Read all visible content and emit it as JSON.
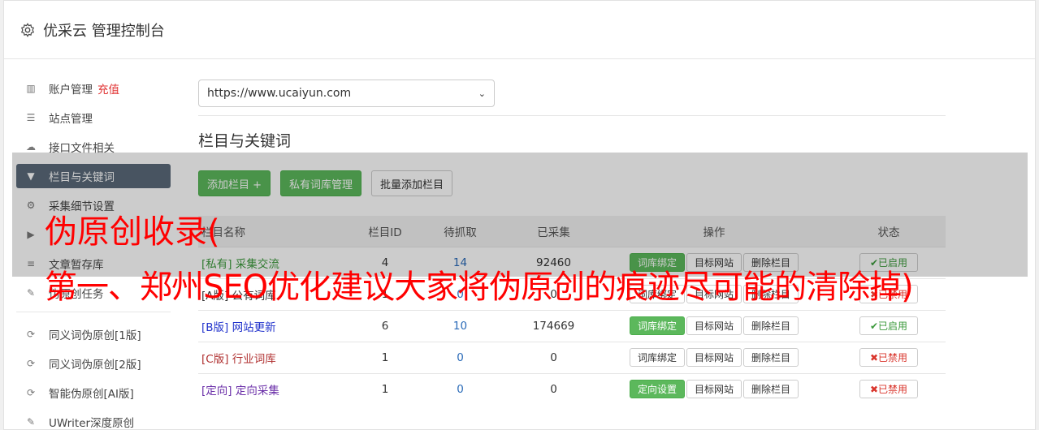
{
  "header": {
    "title": "优采云 管理控制台",
    "icon": "gear-icon"
  },
  "sidebar": {
    "items": [
      {
        "label": "账户管理",
        "extra": "充值",
        "icon": "bar-chart-icon"
      },
      {
        "label": "站点管理",
        "icon": "server-icon"
      },
      {
        "label": "接口文件相关",
        "icon": "cloud-upload-icon"
      },
      {
        "label": "栏目与关键词",
        "icon": "filter-icon",
        "active": true
      },
      {
        "label": "采集细节设置",
        "icon": "cogs-icon"
      },
      {
        "label": "",
        "icon": "play-circle-icon"
      },
      {
        "label": "文章暂存库",
        "icon": "database-icon"
      },
      {
        "label": "伪原创任务",
        "icon": "edit-icon"
      }
    ],
    "tools": [
      {
        "label": "同义词伪原创[1版]",
        "icon": "refresh-icon"
      },
      {
        "label": "同义词伪原创[2版]",
        "icon": "refresh-icon"
      },
      {
        "label": "智能伪原创[AI版]",
        "icon": "refresh-icon"
      },
      {
        "label": "UWriter深度原创",
        "icon": "edit-icon"
      }
    ]
  },
  "main": {
    "site_select": "https://www.ucaiyun.com",
    "section_title": "栏目与关键词",
    "buttons": {
      "add_column": "添加栏目 +",
      "private_lib": "私有词库管理",
      "batch_add": "批量添加栏目"
    },
    "table": {
      "headers": [
        "栏目名称",
        "栏目ID",
        "待抓取",
        "已采集",
        "操作",
        "状态"
      ],
      "rows": [
        {
          "tag": "[私有]",
          "name": "采集交流",
          "id": "4",
          "pending": "14",
          "collected": "92460",
          "op1": "词库绑定",
          "op1_style": "green",
          "op2": "目标网站",
          "op3": "删除栏目",
          "status": "✔已启用",
          "status_type": "on",
          "color": "green"
        },
        {
          "tag": "[A版]",
          "name": "公有词库",
          "id": "1",
          "pending": "0",
          "collected": "0",
          "op1": "词库绑定",
          "op1_style": "default",
          "op2": "目标网站",
          "op3": "删除栏目",
          "status": "✖已禁用",
          "status_type": "off",
          "color": "black"
        },
        {
          "tag": "[B版]",
          "name": "网站更新",
          "id": "6",
          "pending": "10",
          "collected": "174669",
          "op1": "词库绑定",
          "op1_style": "green",
          "op2": "目标网站",
          "op3": "删除栏目",
          "status": "✔已启用",
          "status_type": "on",
          "color": "blue"
        },
        {
          "tag": "[C版]",
          "name": "行业词库",
          "id": "1",
          "pending": "0",
          "collected": "0",
          "op1": "词库绑定",
          "op1_style": "default",
          "op2": "目标网站",
          "op3": "删除栏目",
          "status": "✖已禁用",
          "status_type": "off",
          "color": "red"
        },
        {
          "tag": "[定向]",
          "name": "定向采集",
          "id": "1",
          "pending": "0",
          "collected": "0",
          "op1": "定向设置",
          "op1_style": "green",
          "op2": "目标网站",
          "op3": "删除栏目",
          "status": "✖已禁用",
          "status_type": "off",
          "color": "purple"
        }
      ]
    }
  },
  "watermark": {
    "line1": "伪原创收录(",
    "line2": "第一、郑州SEO优化建议大家将伪原创的痕迹尽可能的清除掉)"
  }
}
